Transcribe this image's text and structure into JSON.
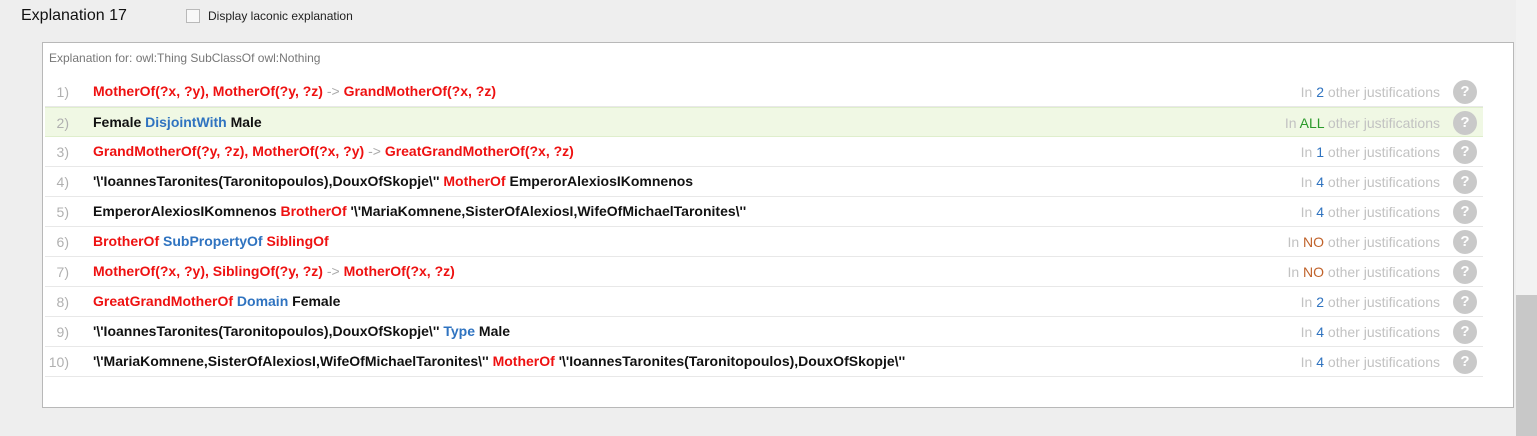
{
  "header": {
    "title": "Explanation 17",
    "laconic_label": "Display laconic explanation",
    "laconic_checked": false
  },
  "panel": {
    "subheader": "Explanation for: owl:Thing SubClassOf owl:Nothing"
  },
  "rows": [
    {
      "num": "1)",
      "segments": [
        {
          "t": "MotherOf(?x, ?y), ",
          "c": "red"
        },
        {
          "t": "MotherOf(?y, ?z) ",
          "c": "red"
        },
        {
          "t": "-> ",
          "c": "arrow"
        },
        {
          "t": "GrandMotherOf(?x, ?z)",
          "c": "red"
        }
      ],
      "just": {
        "pre": "In ",
        "count": "2",
        "count_style": "cnt",
        "post": " other justifications"
      }
    },
    {
      "num": "2)",
      "highlight": true,
      "segments": [
        {
          "t": "Female ",
          "c": "black"
        },
        {
          "t": "DisjointWith ",
          "c": "blue"
        },
        {
          "t": "Male",
          "c": "black"
        }
      ],
      "just": {
        "pre": "In ",
        "count": "ALL",
        "count_style": "all",
        "post": " other justifications"
      }
    },
    {
      "num": "3)",
      "segments": [
        {
          "t": "GrandMotherOf(?y, ?z), ",
          "c": "red"
        },
        {
          "t": "MotherOf(?x, ?y) ",
          "c": "red"
        },
        {
          "t": "-> ",
          "c": "arrow"
        },
        {
          "t": "GreatGrandMotherOf(?x, ?z)",
          "c": "red"
        }
      ],
      "just": {
        "pre": "In ",
        "count": "1",
        "count_style": "cnt",
        "post": " other justifications"
      }
    },
    {
      "num": "4)",
      "segments": [
        {
          "t": "'\\'IoannesTaronites(Taronitopoulos),DouxOfSkopje\\'' ",
          "c": "black"
        },
        {
          "t": "MotherOf ",
          "c": "red"
        },
        {
          "t": "EmperorAlexiosIKomnenos",
          "c": "black"
        }
      ],
      "just": {
        "pre": "In ",
        "count": "4",
        "count_style": "cnt",
        "post": " other justifications"
      }
    },
    {
      "num": "5)",
      "segments": [
        {
          "t": "EmperorAlexiosIKomnenos ",
          "c": "black"
        },
        {
          "t": "BrotherOf ",
          "c": "red"
        },
        {
          "t": "'\\'MariaKomnene,SisterOfAlexiosI,WifeOfMichaelTaronites\\''",
          "c": "black"
        }
      ],
      "just": {
        "pre": "In ",
        "count": "4",
        "count_style": "cnt",
        "post": " other justifications"
      }
    },
    {
      "num": "6)",
      "segments": [
        {
          "t": "BrotherOf ",
          "c": "red"
        },
        {
          "t": "SubPropertyOf ",
          "c": "blue"
        },
        {
          "t": "SiblingOf",
          "c": "red"
        }
      ],
      "just": {
        "pre": "In ",
        "count": "NO",
        "count_style": "no",
        "post": " other justifications"
      }
    },
    {
      "num": "7)",
      "segments": [
        {
          "t": "MotherOf(?x, ?y), ",
          "c": "red"
        },
        {
          "t": "SiblingOf(?y, ?z) ",
          "c": "red"
        },
        {
          "t": "-> ",
          "c": "arrow"
        },
        {
          "t": "MotherOf(?x, ?z)",
          "c": "red"
        }
      ],
      "just": {
        "pre": "In ",
        "count": "NO",
        "count_style": "no",
        "post": " other justifications"
      }
    },
    {
      "num": "8)",
      "segments": [
        {
          "t": "GreatGrandMotherOf ",
          "c": "red"
        },
        {
          "t": "Domain ",
          "c": "blue"
        },
        {
          "t": "Female",
          "c": "black"
        }
      ],
      "just": {
        "pre": "In ",
        "count": "2",
        "count_style": "cnt",
        "post": " other justifications"
      }
    },
    {
      "num": "9)",
      "segments": [
        {
          "t": "'\\'IoannesTaronites(Taronitopoulos),DouxOfSkopje\\'' ",
          "c": "black"
        },
        {
          "t": "Type ",
          "c": "blue"
        },
        {
          "t": "Male",
          "c": "black"
        }
      ],
      "just": {
        "pre": "In ",
        "count": "4",
        "count_style": "cnt",
        "post": " other justifications"
      }
    },
    {
      "num": "10)",
      "segments": [
        {
          "t": "'\\'MariaKomnene,SisterOfAlexiosI,WifeOfMichaelTaronites\\'' ",
          "c": "black"
        },
        {
          "t": "MotherOf ",
          "c": "red"
        },
        {
          "t": "'\\'IoannesTaronites(Taronitopoulos),DouxOfSkopje\\''",
          "c": "black"
        }
      ],
      "just": {
        "pre": "In ",
        "count": "4",
        "count_style": "cnt",
        "post": " other justifications"
      }
    }
  ],
  "help_glyph": "?",
  "icons": {
    "help": "help-circle-icon",
    "checkbox": "checkbox-icon"
  },
  "colors": {
    "keyword_red": "#ee1111",
    "keyword_blue": "#2f73c0",
    "all": "#2a9a2a",
    "no": "#c0622a",
    "highlight_row": "#f0f8e4"
  }
}
